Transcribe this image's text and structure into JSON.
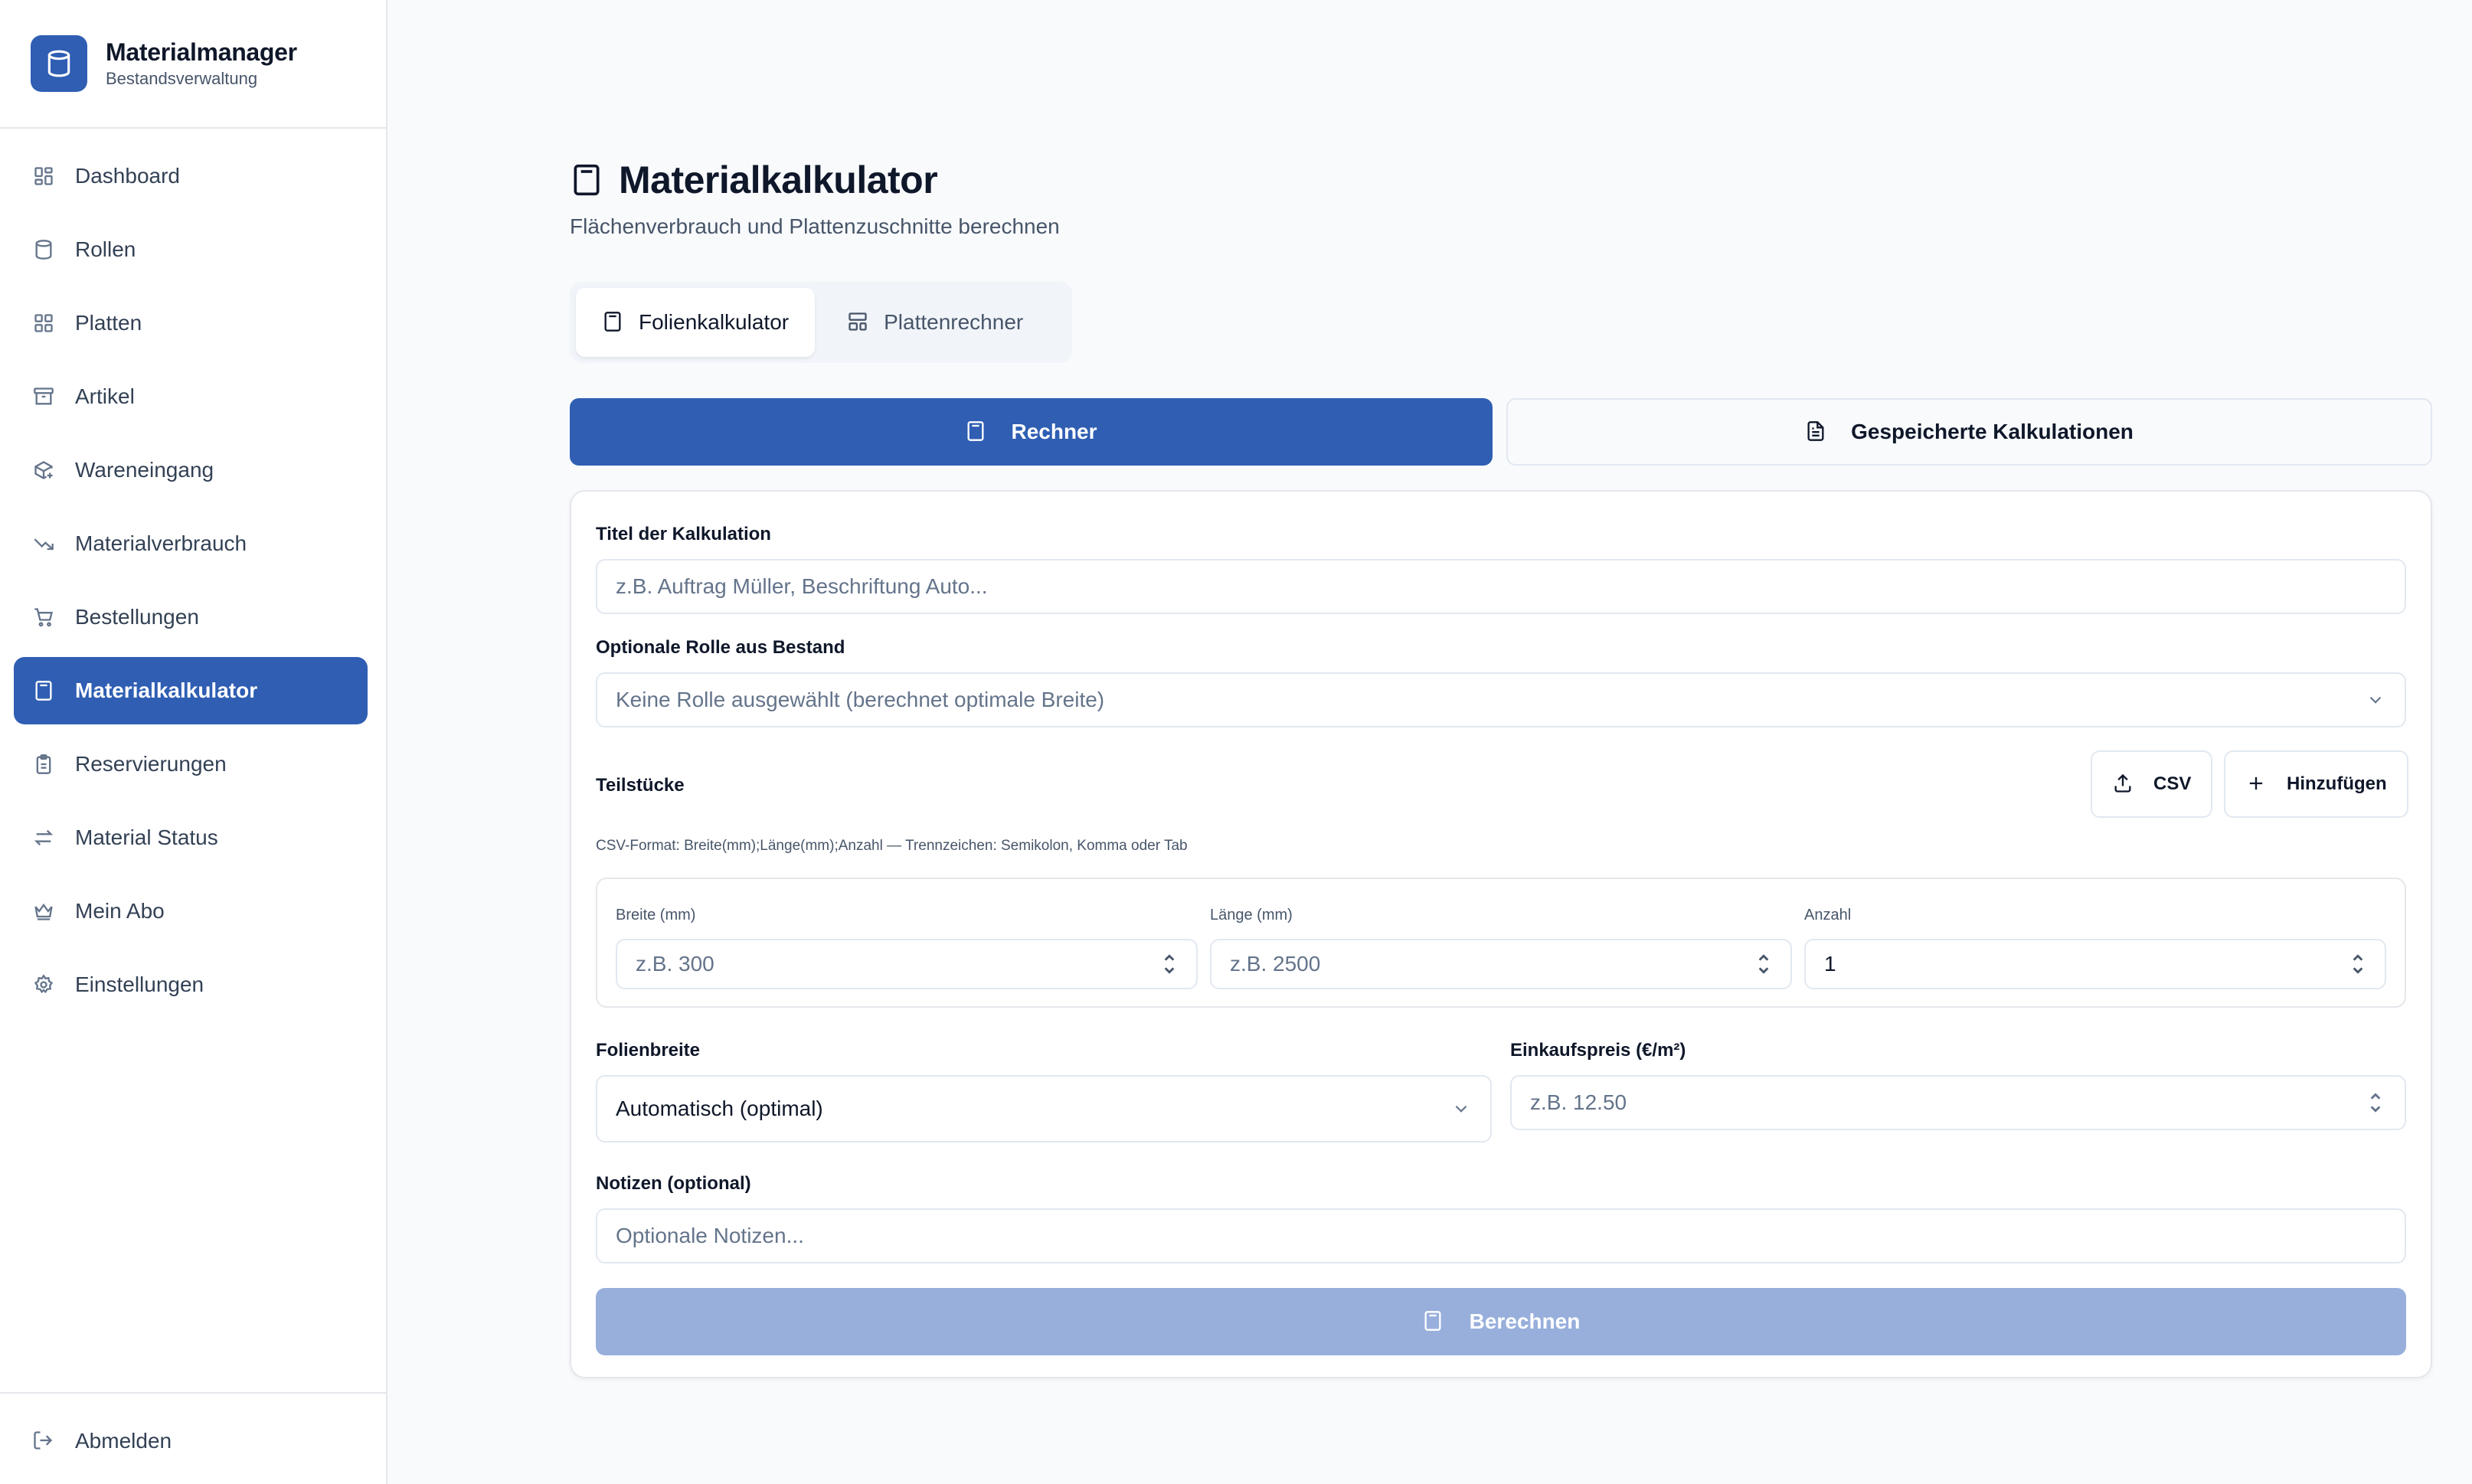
{
  "app": {
    "name": "Materialmanager",
    "subtitle": "Bestandsverwaltung",
    "accent_color": "#2f5eb3"
  },
  "sidebar": {
    "items": [
      {
        "label": "Dashboard",
        "icon": "dashboard-icon"
      },
      {
        "label": "Rollen",
        "icon": "cylinder-icon"
      },
      {
        "label": "Platten",
        "icon": "grid-icon"
      },
      {
        "label": "Artikel",
        "icon": "archive-icon"
      },
      {
        "label": "Wareneingang",
        "icon": "package-plus-icon"
      },
      {
        "label": "Materialverbrauch",
        "icon": "trending-down-icon"
      },
      {
        "label": "Bestellungen",
        "icon": "cart-icon"
      },
      {
        "label": "Materialkalkulator",
        "icon": "calculator-icon",
        "active": true
      },
      {
        "label": "Reservierungen",
        "icon": "clipboard-icon"
      },
      {
        "label": "Material Status",
        "icon": "arrows-swap-icon"
      },
      {
        "label": "Mein Abo",
        "icon": "crown-icon"
      },
      {
        "label": "Einstellungen",
        "icon": "gear-icon"
      }
    ],
    "logout_label": "Abmelden"
  },
  "page": {
    "title": "Materialkalkulator",
    "subtitle": "Flächenverbrauch und Plattenzuschnitte berechnen",
    "tabs": [
      {
        "label": "Folienkalkulator",
        "active": true
      },
      {
        "label": "Plattenrechner",
        "active": false
      }
    ],
    "segments": {
      "calculator": "Rechner",
      "saved": "Gespeicherte Kalkulationen"
    }
  },
  "form": {
    "title_label": "Titel der Kalkulation",
    "title_placeholder": "z.B. Auftrag Müller, Beschriftung Auto...",
    "roll_label": "Optionale Rolle aus Bestand",
    "roll_value": "Keine Rolle ausgewählt (berechnet optimale Breite)",
    "pieces_label": "Teilstücke",
    "csv_button": "CSV",
    "add_button": "Hinzufügen",
    "csv_hint": "CSV-Format: Breite(mm);Länge(mm);Anzahl — Trennzeichen: Semikolon, Komma oder Tab",
    "piece": {
      "width_label": "Breite (mm)",
      "width_placeholder": "z.B. 300",
      "length_label": "Länge (mm)",
      "length_placeholder": "z.B. 2500",
      "count_label": "Anzahl",
      "count_value": "1"
    },
    "foil_width_label": "Folienbreite",
    "foil_width_value": "Automatisch (optimal)",
    "price_label": "Einkaufspreis (€/m²)",
    "price_placeholder": "z.B. 12.50",
    "notes_label": "Notizen (optional)",
    "notes_placeholder": "Optionale Notizen...",
    "submit_label": "Berechnen"
  }
}
